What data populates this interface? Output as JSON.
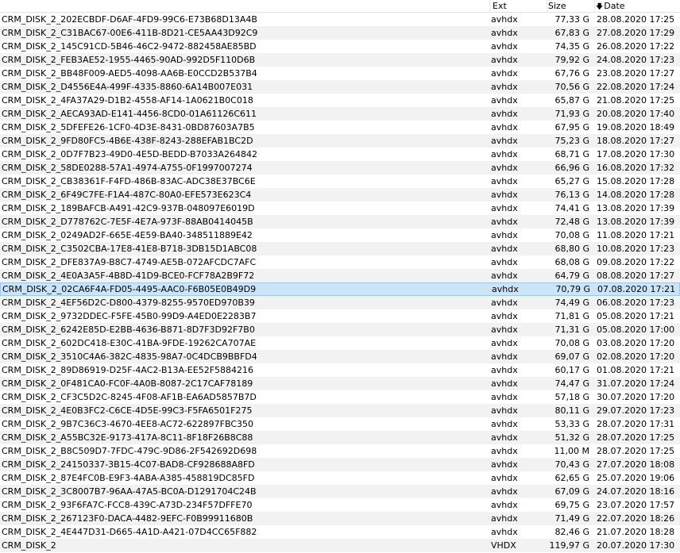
{
  "header": {
    "ext": "Ext",
    "size": "Size",
    "date": "Date",
    "sort_icon": "sort-down-arrow"
  },
  "colors": {
    "selected_bg": "#cce4f7",
    "selected_border": "#99c9ef",
    "alt_row": "#f2f2f2"
  },
  "selected_index": 20,
  "files": [
    {
      "name": "CRM_DISK_2_202ECBDF-D6AF-4FD9-99C6-E73B68D13A4B",
      "ext": "avhdx",
      "size": "77,33 G",
      "date": "28.08.2020 17:25"
    },
    {
      "name": "CRM_DISK_2_C31BAC67-00E6-411B-8D21-CE5AA43D92C9",
      "ext": "avhdx",
      "size": "67,83 G",
      "date": "27.08.2020 17:29"
    },
    {
      "name": "CRM_DISK_2_145C91CD-5B46-46C2-9472-882458AE85BD",
      "ext": "avhdx",
      "size": "74,35 G",
      "date": "26.08.2020 17:22"
    },
    {
      "name": "CRM_DISK_2_FEB3AE52-1955-4465-90AD-992D5F110D6B",
      "ext": "avhdx",
      "size": "79,92 G",
      "date": "24.08.2020 17:23"
    },
    {
      "name": "CRM_DISK_2_BB48F009-AED5-4098-AA6B-E0CCD2B537B4",
      "ext": "avhdx",
      "size": "67,76 G",
      "date": "23.08.2020 17:27"
    },
    {
      "name": "CRM_DISK_2_D4556E4A-499F-4335-8860-6A14B007E031",
      "ext": "avhdx",
      "size": "70,56 G",
      "date": "22.08.2020 17:24"
    },
    {
      "name": "CRM_DISK_2_4FA37A29-D1B2-4558-AF14-1A0621B0C018",
      "ext": "avhdx",
      "size": "65,87 G",
      "date": "21.08.2020 17:25"
    },
    {
      "name": "CRM_DISK_2_AECA93AD-E141-4456-8CD0-01A61126C611",
      "ext": "avhdx",
      "size": "71,93 G",
      "date": "20.08.2020 17:40"
    },
    {
      "name": "CRM_DISK_2_5DFEFE26-1CF0-4D3E-8431-0BD87603A7B5",
      "ext": "avhdx",
      "size": "67,95 G",
      "date": "19.08.2020 18:49"
    },
    {
      "name": "CRM_DISK_2_9FD80FC5-4B6E-438F-8243-288EFAB1BC2D",
      "ext": "avhdx",
      "size": "75,23 G",
      "date": "18.08.2020 17:27"
    },
    {
      "name": "CRM_DISK_2_0D7F7B23-49D0-4E5D-BEDD-B7033A264842",
      "ext": "avhdx",
      "size": "68,71 G",
      "date": "17.08.2020 17:30"
    },
    {
      "name": "CRM_DISK_2_58DE0288-57A1-4974-A755-0F1997007274",
      "ext": "avhdx",
      "size": "66,96 G",
      "date": "16.08.2020 17:32"
    },
    {
      "name": "CRM_DISK_2_CB38361F-F4FD-486B-83AC-ADC38E37BC6E",
      "ext": "avhdx",
      "size": "65,27 G",
      "date": "15.08.2020 17:28"
    },
    {
      "name": "CRM_DISK_2_6F49C7FE-F1A4-487C-80A0-EFE573E623C4",
      "ext": "avhdx",
      "size": "76,13 G",
      "date": "14.08.2020 17:28"
    },
    {
      "name": "CRM_DISK_2_189BAFCB-A491-42C9-937B-048097E6019D",
      "ext": "avhdx",
      "size": "74,41 G",
      "date": "13.08.2020 17:39"
    },
    {
      "name": "CRM_DISK_2_D778762C-7E5F-4E7A-973F-88AB0414045B",
      "ext": "avhdx",
      "size": "72,48 G",
      "date": "13.08.2020 17:39"
    },
    {
      "name": "CRM_DISK_2_0249AD2F-665E-4E59-BA40-348511889E42",
      "ext": "avhdx",
      "size": "70,08 G",
      "date": "11.08.2020 17:21"
    },
    {
      "name": "CRM_DISK_2_C3502CBA-17E8-41E8-B718-3DB15D1ABC08",
      "ext": "avhdx",
      "size": "68,80 G",
      "date": "10.08.2020 17:23"
    },
    {
      "name": "CRM_DISK_2_DFE837A9-B8C7-4749-AE5B-072AFCDC7AFC",
      "ext": "avhdx",
      "size": "68,08 G",
      "date": "09.08.2020 17:22"
    },
    {
      "name": "CRM_DISK_2_4E0A3A5F-4B8D-41D9-BCE0-FCF78A2B9F72",
      "ext": "avhdx",
      "size": "64,79 G",
      "date": "08.08.2020 17:27"
    },
    {
      "name": "CRM_DISK_2_02CA6F4A-FD05-4495-AAC0-F6B05E0B49D9",
      "ext": "avhdx",
      "size": "70,79 G",
      "date": "07.08.2020 17:21"
    },
    {
      "name": "CRM_DISK_2_4EF56D2C-D800-4379-8255-9570ED970B39",
      "ext": "avhdx",
      "size": "74,49 G",
      "date": "06.08.2020 17:23"
    },
    {
      "name": "CRM_DISK_2_9732DDEC-F5FE-45B0-99D9-A4ED0E2283B7",
      "ext": "avhdx",
      "size": "71,81 G",
      "date": "05.08.2020 17:21"
    },
    {
      "name": "CRM_DISK_2_6242E85D-E2BB-4636-B871-8D7F3D92F7B0",
      "ext": "avhdx",
      "size": "71,31 G",
      "date": "05.08.2020 17:00"
    },
    {
      "name": "CRM_DISK_2_602DC418-E30C-41BA-9FDE-19262CA707AE",
      "ext": "avhdx",
      "size": "70,08 G",
      "date": "03.08.2020 17:20"
    },
    {
      "name": "CRM_DISK_2_3510C4A6-382C-4835-98A7-0C4DCB9BBFD4",
      "ext": "avhdx",
      "size": "69,07 G",
      "date": "02.08.2020 17:20"
    },
    {
      "name": "CRM_DISK_2_89D86919-D25F-4AC2-B13A-EE52F5884216",
      "ext": "avhdx",
      "size": "60,17 G",
      "date": "01.08.2020 17:21"
    },
    {
      "name": "CRM_DISK_2_0F481CA0-FC0F-4A0B-8087-2C17CAF78189",
      "ext": "avhdx",
      "size": "74,47 G",
      "date": "31.07.2020 17:24"
    },
    {
      "name": "CRM_DISK_2_CF3C5D2C-8245-4F08-AF1B-EA6AD5857B7D",
      "ext": "avhdx",
      "size": "57,18 G",
      "date": "30.07.2020 17:20"
    },
    {
      "name": "CRM_DISK_2_4E0B3FC2-C6CE-4D5E-99C3-F5FA6501F275",
      "ext": "avhdx",
      "size": "80,11 G",
      "date": "29.07.2020 17:23"
    },
    {
      "name": "CRM_DISK_2_9B7C36C3-4670-4EE8-AC72-622897FBC350",
      "ext": "avhdx",
      "size": "53,33 G",
      "date": "28.07.2020 17:31"
    },
    {
      "name": "CRM_DISK_2_A55BC32E-9173-417A-8C11-8F18F26B8C88",
      "ext": "avhdx",
      "size": "51,32 G",
      "date": "28.07.2020 17:25"
    },
    {
      "name": "CRM_DISK_2_B8C509D7-7FDC-479C-9D86-2F542692D698",
      "ext": "avhdx",
      "size": "11,00 M",
      "date": "28.07.2020 17:25"
    },
    {
      "name": "CRM_DISK_2_24150337-3B15-4C07-BAD8-CF928688A8FD",
      "ext": "avhdx",
      "size": "70,43 G",
      "date": "27.07.2020 18:08"
    },
    {
      "name": "CRM_DISK_2_87E4FC0B-E9F3-4ABA-A385-458819DC85FD",
      "ext": "avhdx",
      "size": "62,65 G",
      "date": "25.07.2020 19:06"
    },
    {
      "name": "CRM_DISK_2_3C8007B7-96AA-47A5-BC0A-D1291704C24B",
      "ext": "avhdx",
      "size": "67,09 G",
      "date": "24.07.2020 18:16"
    },
    {
      "name": "CRM_DISK_2_93F6FA7C-FCC8-439C-A73D-234F57DFFE70",
      "ext": "avhdx",
      "size": "69,75 G",
      "date": "23.07.2020 17:57"
    },
    {
      "name": "CRM_DISK_2_267123F0-DACA-4482-9EFC-F0B99911680B",
      "ext": "avhdx",
      "size": "71,49 G",
      "date": "22.07.2020 18:26"
    },
    {
      "name": "CRM_DISK_2_4E447D31-D665-4A1D-A421-07D4CC65F882",
      "ext": "avhdx",
      "size": "82,46 G",
      "date": "21.07.2020 18:28"
    },
    {
      "name": "CRM_DISK_2",
      "ext": "VHDX",
      "size": "119,97 G",
      "date": "20.07.2020 17:30"
    }
  ]
}
